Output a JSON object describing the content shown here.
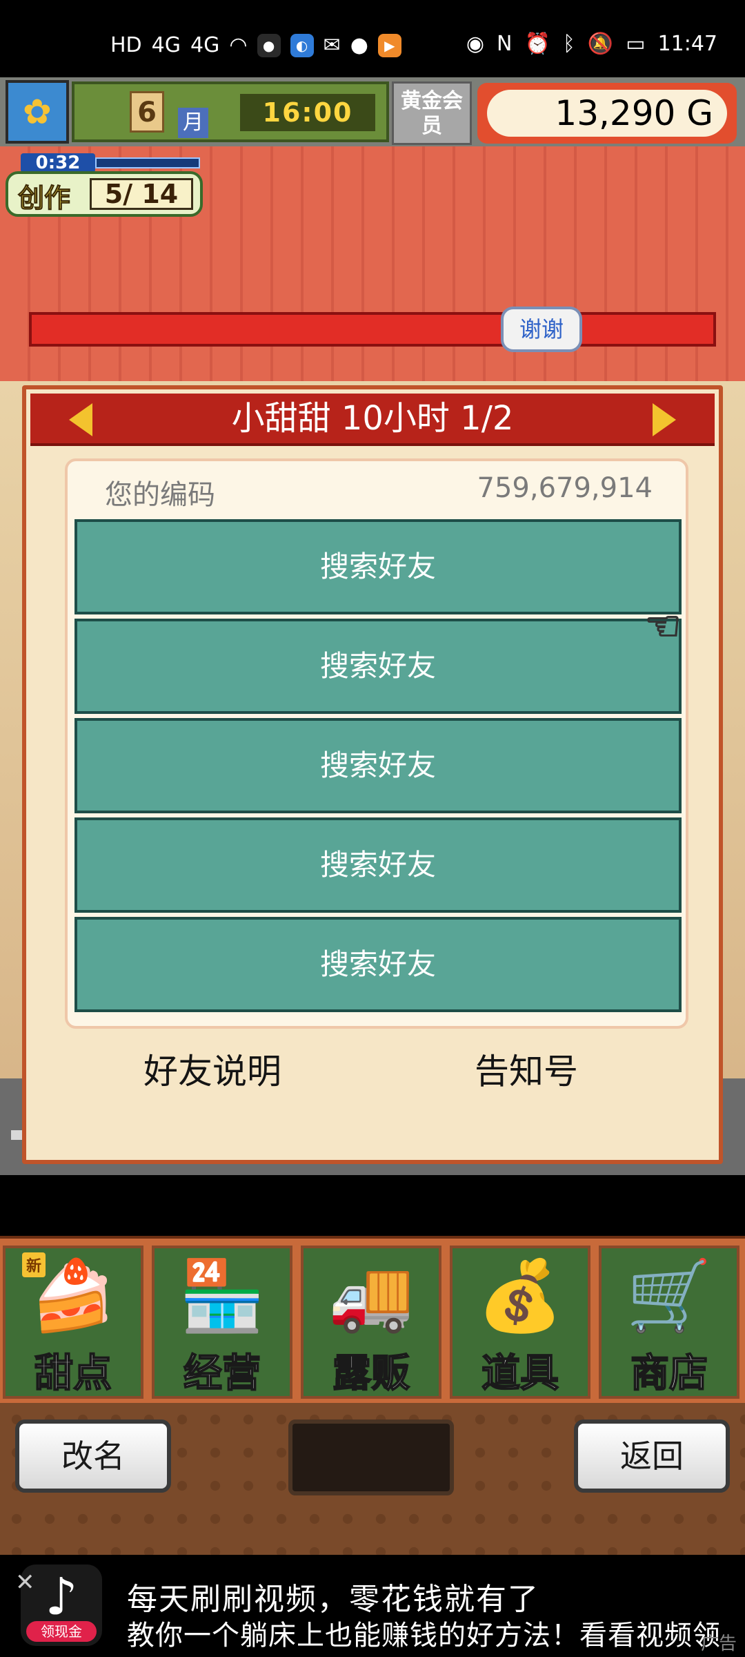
{
  "status_bar": {
    "left_indicators": [
      "HD",
      "4G",
      "4G",
      "wifi"
    ],
    "time": "11:47"
  },
  "hud": {
    "month_number": "6",
    "month_label": "月",
    "time": "16:00",
    "gold_member_label": "黄金会员",
    "money": "13,290 G",
    "create_timer": "0:32",
    "create_label": "创作",
    "create_count": "5/ 14"
  },
  "banner": {
    "thanks_bubble": "谢谢"
  },
  "panel": {
    "title": "小甜甜  10小时 1/2",
    "code_label": "您的编码",
    "code_value": "759,679,914",
    "slots": [
      "搜索好友",
      "搜索好友",
      "搜索好友",
      "搜索好友",
      "搜索好友"
    ],
    "friend_help": "好友说明",
    "notice": "告知号"
  },
  "menu": {
    "new_tag": "新",
    "items": [
      {
        "label": "甜点",
        "icon": "cake-icon"
      },
      {
        "label": "经营",
        "icon": "shop-icon"
      },
      {
        "label": "露贩",
        "icon": "food-truck-icon"
      },
      {
        "label": "道具",
        "icon": "items-bag-icon"
      },
      {
        "label": "商店",
        "icon": "shopping-cart-icon"
      }
    ]
  },
  "controls": {
    "rename": "改名",
    "back": "返回"
  },
  "ad": {
    "line1": "每天刷刷视频，零花钱就有了",
    "line2": "教你一个躺床上也能赚钱的好方法！看看视频领",
    "reward": "领现金",
    "tag": "广告"
  }
}
